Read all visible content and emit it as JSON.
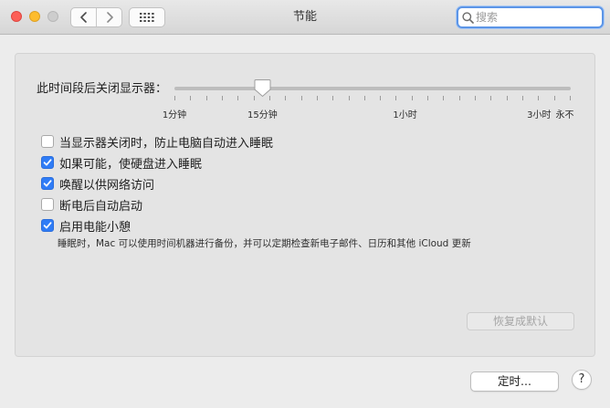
{
  "window": {
    "title": "节能"
  },
  "search": {
    "placeholder": "搜索"
  },
  "slider": {
    "label": "此时间段后关闭显示器：",
    "tick_labels": [
      "1分钟",
      "15分钟",
      "1小时",
      "3小时",
      "永不"
    ],
    "value_label": "15分钟"
  },
  "options": [
    {
      "label": "当显示器关闭时，防止电脑自动进入睡眠",
      "checked": false
    },
    {
      "label": "如果可能，使硬盘进入睡眠",
      "checked": true
    },
    {
      "label": "唤醒以供网络访问",
      "checked": true
    },
    {
      "label": "断电后自动启动",
      "checked": false
    },
    {
      "label": "启用电能小憩",
      "checked": true
    }
  ],
  "power_nap_description": "睡眠时，Mac 可以使用时间机器进行备份，并可以定期检查新电子邮件、日历和其他 iCloud 更新",
  "buttons": {
    "restore_defaults": "恢复成默认",
    "schedule": "定时...",
    "help": "?"
  },
  "colors": {
    "accent": "#2f7cf6",
    "close": "#fc5f57",
    "minimize": "#fdbc2e"
  },
  "icons": {
    "back": "chevron-left-icon",
    "forward": "chevron-right-icon",
    "show_all": "grid-icon",
    "search": "search-icon",
    "check": "checkmark-icon"
  }
}
